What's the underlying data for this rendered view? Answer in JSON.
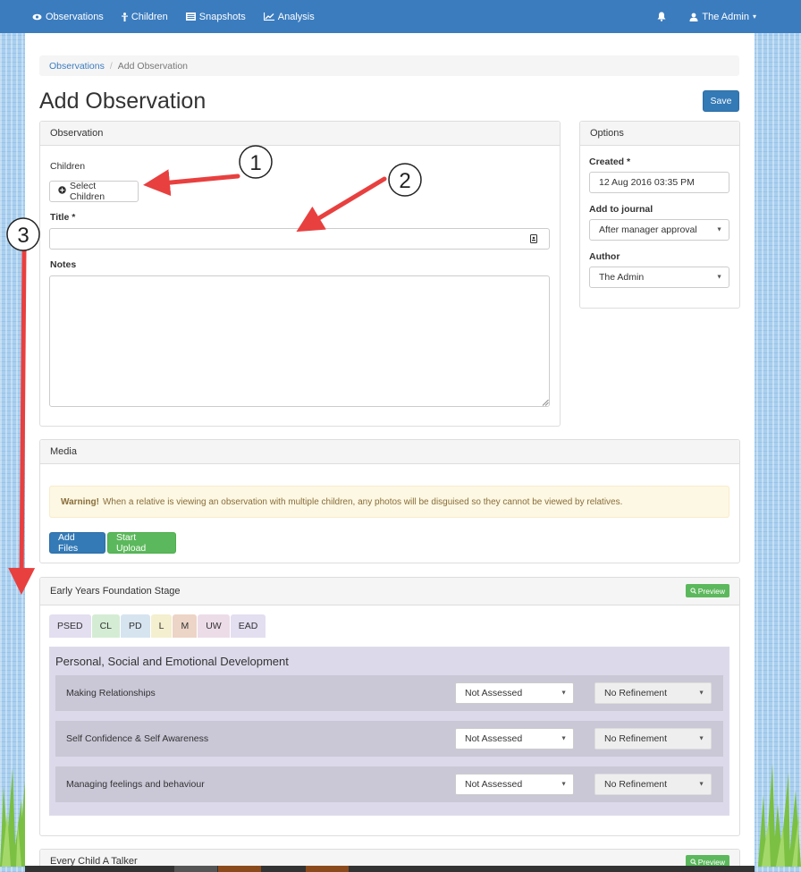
{
  "navbar": {
    "items": [
      {
        "icon": "eye-icon",
        "label": "Observations"
      },
      {
        "icon": "child-icon",
        "label": "Children"
      },
      {
        "icon": "snapshots-icon",
        "label": "Snapshots"
      },
      {
        "icon": "chart-icon",
        "label": "Analysis"
      }
    ],
    "user_label": "The Admin",
    "user_caret": "▾"
  },
  "breadcrumb": {
    "link": "Observations",
    "separator": "/",
    "current": "Add Observation"
  },
  "page_title": "Add Observation",
  "save_label": "Save",
  "observation_panel": {
    "heading": "Observation",
    "children_label": "Children",
    "select_children_label": "Select Children",
    "title_label": "Title *",
    "title_value": "",
    "notes_label": "Notes",
    "notes_value": ""
  },
  "options_panel": {
    "heading": "Options",
    "created_label": "Created *",
    "created_value": "12 Aug 2016 03:35 PM",
    "journal_label": "Add to journal",
    "journal_value": "After manager approval",
    "author_label": "Author",
    "author_value": "The Admin"
  },
  "media_panel": {
    "heading": "Media",
    "warning_strong": "Warning!",
    "warning_text": "When a relative is viewing an observation with multiple children, any photos will be disguised so they cannot be viewed by relatives.",
    "add_files_label": "Add Files",
    "start_upload_label": "Start Upload"
  },
  "eyfs_panel": {
    "heading": "Early Years Foundation Stage",
    "preview_label": "Preview",
    "tabs": [
      {
        "label": "PSED",
        "color": "#e3def0"
      },
      {
        "label": "CL",
        "color": "#d5ecd4"
      },
      {
        "label": "PD",
        "color": "#d6e4f0"
      },
      {
        "label": "L",
        "color": "#f3efcf"
      },
      {
        "label": "M",
        "color": "#ecd4c6"
      },
      {
        "label": "UW",
        "color": "#ecdce8"
      },
      {
        "label": "EAD",
        "color": "#e3def0"
      }
    ],
    "area_title": "Personal, Social and Emotional Development",
    "aspects": [
      {
        "name": "Making Relationships",
        "assessment": "Not Assessed",
        "refinement": "No Refinement"
      },
      {
        "name": "Self Confidence & Self Awareness",
        "assessment": "Not Assessed",
        "refinement": "No Refinement"
      },
      {
        "name": "Managing feelings and behaviour",
        "assessment": "Not Assessed",
        "refinement": "No Refinement"
      }
    ]
  },
  "talker_panel": {
    "heading": "Every Child A Talker",
    "preview_label": "Preview"
  },
  "annotations": [
    {
      "number": "1"
    },
    {
      "number": "2"
    },
    {
      "number": "3"
    }
  ],
  "colors": {
    "navbar": "#3b7cbf",
    "primary": "#337ab7",
    "success": "#5cb85c",
    "arrow": "#e8403f"
  }
}
